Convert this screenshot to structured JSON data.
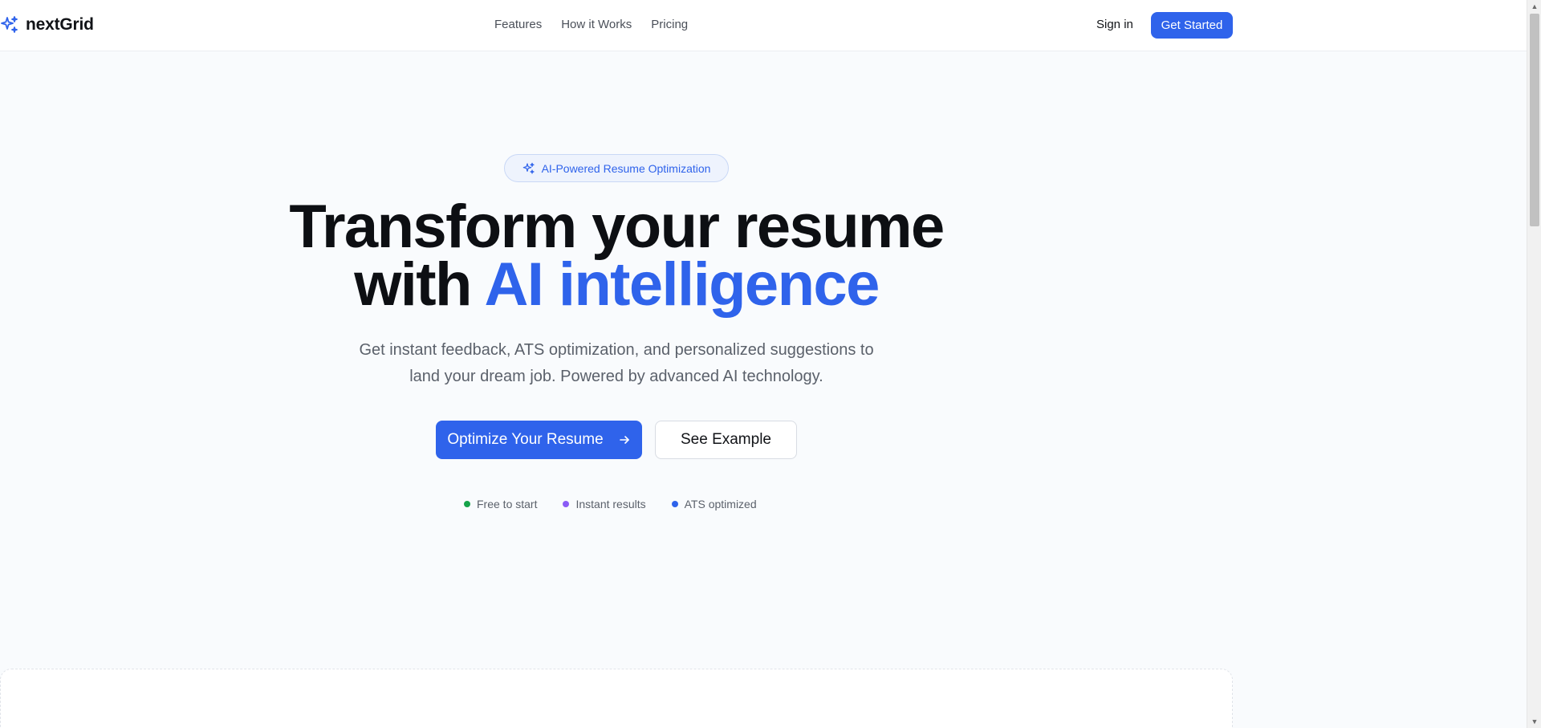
{
  "header": {
    "logo_text": "nextGrid",
    "nav": [
      "Features",
      "How it Works",
      "Pricing"
    ],
    "sign_in": "Sign in",
    "get_started": "Get Started"
  },
  "hero": {
    "badge": "AI-Powered Resume Optimization",
    "headline_line1": "Transform your resume",
    "headline_line2_prefix": "with ",
    "headline_line2_accent": "AI intelligence",
    "subtitle_line1": "Get instant feedback, ATS optimization, and personalized suggestions to",
    "subtitle_line2": "land your dream job. Powered by advanced AI technology.",
    "primary_cta": "Optimize Your Resume",
    "secondary_cta": "See Example",
    "features": [
      {
        "label": "Free to start",
        "color": "#16a34a"
      },
      {
        "label": "Instant results",
        "color": "#8b5cf6"
      },
      {
        "label": "ATS optimized",
        "color": "#2f63eb"
      }
    ]
  },
  "colors": {
    "accent": "#2f63eb",
    "background": "#f9fbfd"
  },
  "icons": {
    "logo": "sparkles-icon",
    "badge": "sparkles-icon",
    "cta": "arrow-right-icon"
  }
}
